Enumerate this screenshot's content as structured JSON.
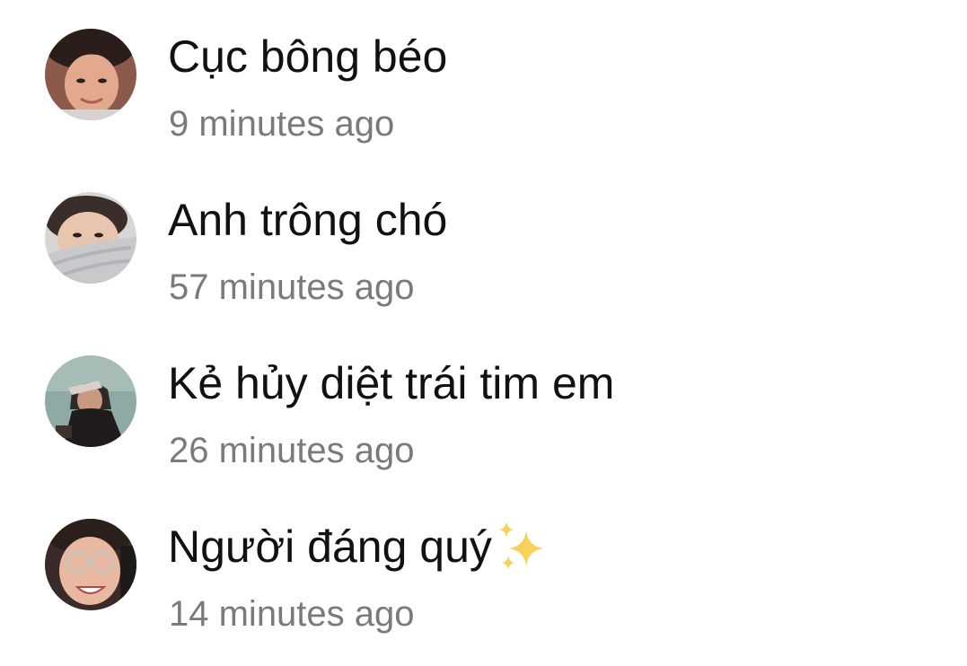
{
  "conversations": [
    {
      "name": "Cục bông béo",
      "time": "9 minutes ago",
      "avatar_icon": "avatar-photo"
    },
    {
      "name": "Anh trông chó",
      "time": "57 minutes ago",
      "avatar_icon": "avatar-photo"
    },
    {
      "name": "Kẻ hủy diệt trái tim em",
      "time": "26 minutes ago",
      "avatar_icon": "avatar-photo"
    },
    {
      "name": "Người đáng quý",
      "time": "14 minutes ago",
      "avatar_icon": "avatar-photo",
      "emoji": "sparkles-icon"
    }
  ],
  "colors": {
    "background": "#ffffff",
    "name_text": "#111111",
    "time_text": "#7a7a7a",
    "sparkle": "#f5c84a"
  }
}
